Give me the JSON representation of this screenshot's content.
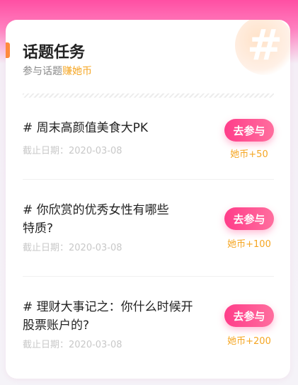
{
  "header": {
    "title": "话题任务",
    "subtitle_prefix": "参与话题",
    "subtitle_highlight": "赚她币",
    "decor_icon": "hash-icon"
  },
  "join_label": "去参与",
  "tasks": [
    {
      "title": "# 周末高颜值美食大PK",
      "date": "截止日期：2020-03-08",
      "reward": "她币+50"
    },
    {
      "title": "# 你欣赏的优秀女性有哪些特质?",
      "date": "截止日期：2020-03-08",
      "reward": "她币+100"
    },
    {
      "title": "# 理财大事记之：你什么时候开股票账户的?",
      "date": "截止日期：2020-03-08",
      "reward": "她币+200"
    }
  ],
  "colors": {
    "accent_pink": "#ff3d8a",
    "accent_orange": "#f5a623",
    "bar_orange": "#ff8a3d"
  }
}
